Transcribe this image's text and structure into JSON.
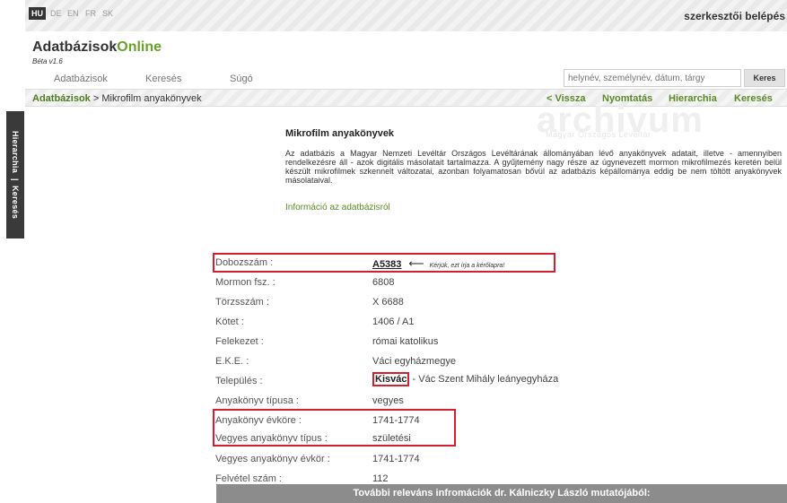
{
  "side_tab": {
    "hierarchia": "Hierarchia",
    "separator": "|",
    "kereses": "Keresés"
  },
  "languages": [
    "HU",
    "DE",
    "EN",
    "FR",
    "SK"
  ],
  "header": {
    "editor_login": "szerkesztői belépés",
    "logo_main": "Adatbázisok",
    "logo_accent": "Online",
    "beta": "Béta v1.6",
    "nav": [
      "Adatbázisok",
      "Keresés",
      "Súgó"
    ],
    "search_placeholder": "helynév, személynév, dátum, tárgy",
    "search_button": "Keres"
  },
  "breadcrumb": {
    "root": "Adatbázisok",
    "separator": " > ",
    "current": "Mikrofilm anyakönyvek",
    "links": [
      "< Vissza",
      "Nyomtatás",
      "Hierarchia",
      "Keresés"
    ]
  },
  "watermark": {
    "main": "archivum",
    "sub": "Magyar Országos Levéltár"
  },
  "intro": {
    "title": "Mikrofilm anyakönyvek",
    "text": "Az adatbázis a Magyar Nemzeti Levéltár Országos Levéltárának állományában lévő anyakönyvek adatait, illetve - amennyiben rendelkezésre áll - azok digitális másolatait tartalmazza. A gyűjtemény nagy része az úgynevezett mormon mikrofilmezés keretén belül készült mikrofilmek szkennelt változatai, azonban folyamatosan bővül az adatbázis képállománya eddig be nem töltött anyakönyvek másolataival.",
    "info_link": "Információ az adatbázisról"
  },
  "record": {
    "dobozszam_label": "Dobozszám :",
    "dobozszam_value": "A5383",
    "arrow": "⟵",
    "dobozszam_note": "Kérjük, ezt írja a kérőlapra!",
    "mormon_label": "Mormon fsz. :",
    "mormon_value": "6808",
    "torzs_label": "Törzsszám :",
    "torzs_value": "X 6688",
    "kotet_label": "Kötet :",
    "kotet_value": "1406 / A1",
    "felekezet_label": "Felekezet :",
    "felekezet_value": "római katolikus",
    "eke_label": "E.K.E. :",
    "eke_value": "Váci egyházmegye",
    "telepules_label": "Település :",
    "telepules_bold": "Kisvác",
    "telepules_rest": " - Vác Szent Mihály leányegyháza",
    "tipus_label": "Anyakönyv típusa :",
    "tipus_value": "vegyes",
    "evkore_label": "Anyakönyv évköre :",
    "evkore_value": "1741-1774",
    "vegyes_tipus_label": "Vegyes anyakönyv típus :",
    "vegyes_tipus_value": "születési",
    "vegyes_evkor_label": "Vegyes anyakönyv évkör :",
    "vegyes_evkor_value": "1741-1774",
    "felvetel_label": "Felvétel szám :",
    "felvetel_value": "112"
  },
  "bottom_bar": "További releváns infromációk dr. Kálniczky László mutatójából:",
  "colors": {
    "accent_green": "#5a8b25",
    "highlight_red": "#d2202f",
    "dark": "#333333"
  }
}
